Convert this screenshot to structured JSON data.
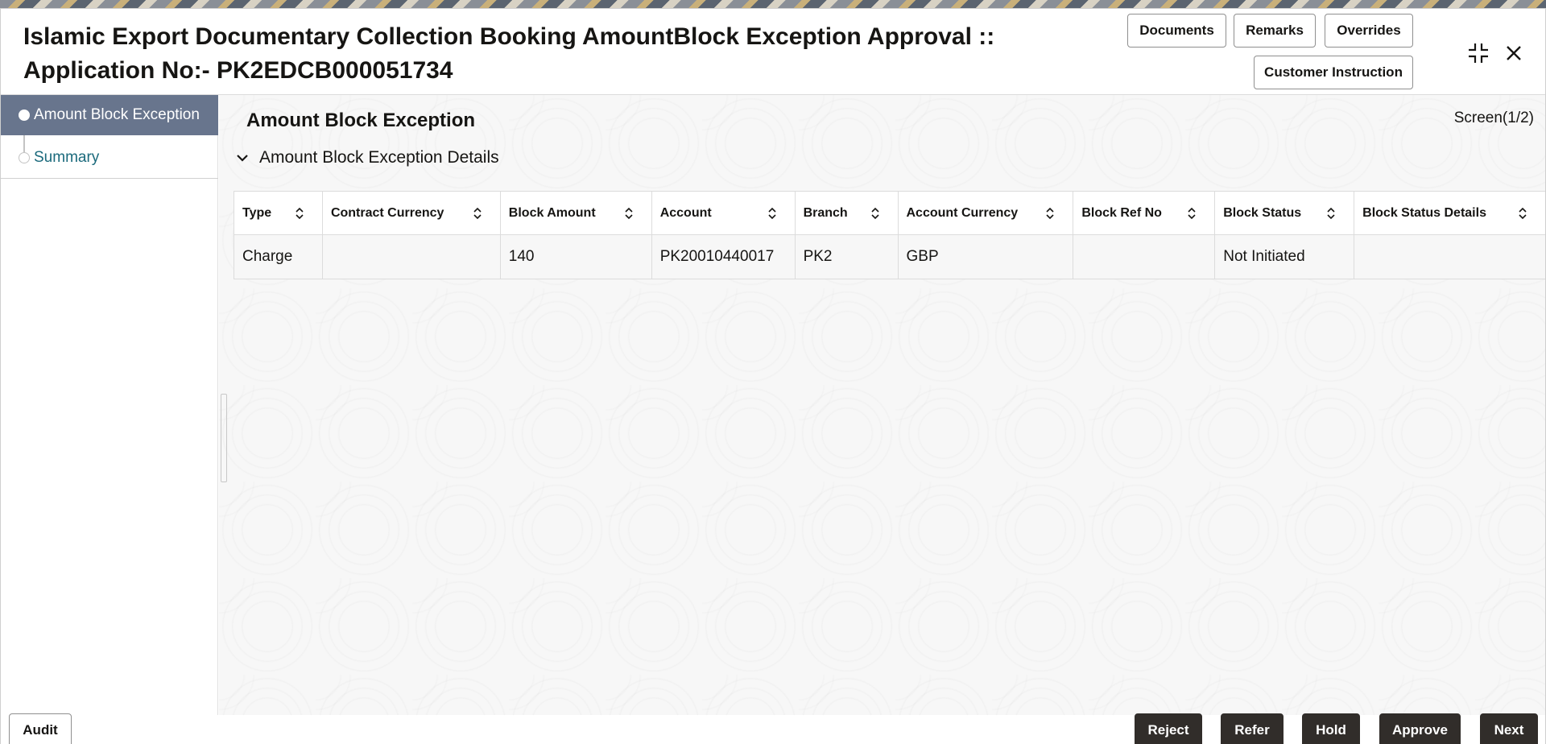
{
  "header": {
    "title": "Islamic Export Documentary Collection Booking AmountBlock Exception Approval :: Application No:- PK2EDCB000051734",
    "buttons": {
      "documents": "Documents",
      "remarks": "Remarks",
      "overrides": "Overrides",
      "customer_instruction": "Customer Instruction"
    },
    "icons": [
      "minimize-icon",
      "close-icon"
    ]
  },
  "sidebar": {
    "items": [
      {
        "label": "Amount Block Exception",
        "active": true
      },
      {
        "label": "Summary",
        "active": false
      }
    ]
  },
  "main": {
    "section_title": "Amount Block Exception",
    "screen_indicator": "Screen(1/2)",
    "details_title": "Amount Block Exception Details",
    "table": {
      "columns": [
        "Type",
        "Contract Currency",
        "Block Amount",
        "Account",
        "Branch",
        "Account Currency",
        "Block Ref No",
        "Block Status",
        "Block Status Details"
      ],
      "rows": [
        [
          "Charge",
          "",
          "140",
          "PK20010440017",
          "PK2",
          "GBP",
          "",
          "Not Initiated",
          ""
        ]
      ]
    }
  },
  "footer": {
    "audit": "Audit",
    "reject": "Reject",
    "refer": "Refer",
    "hold": "Hold",
    "approve": "Approve",
    "next": "Next"
  },
  "colors": {
    "sidebar_active_bg": "#68758d",
    "nav_link": "#1b6a7c",
    "dark_button": "#312d2a"
  }
}
